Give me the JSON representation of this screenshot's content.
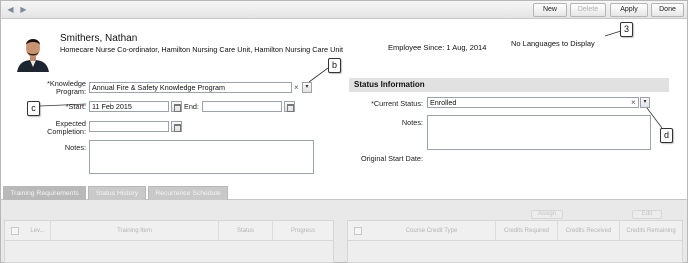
{
  "toolbar": {
    "nav_prev": "◀",
    "nav_next": "▶",
    "buttons": {
      "new": "New",
      "delete": "Delete",
      "apply": "Apply",
      "done": "Done"
    }
  },
  "employee": {
    "name": "Smithers, Nathan",
    "title": "Homecare Nurse Co-ordinator, Hamilton Nursing Care Unit, Hamilton Nursing Care Unit",
    "since": "Employee Since: 1 Aug, 2014",
    "languages": "No Languages to Display"
  },
  "form": {
    "knowledge_program_label": "*Knowledge Program:",
    "knowledge_program_value": "Annual Fire & Safety Knowledge Program",
    "start_label": "*Start:",
    "start_value": "11 Feb 2015",
    "end_label": "End:",
    "end_value": "",
    "expected_completion_label": "Expected Completion:",
    "expected_completion_value": "",
    "notes_label": "Notes:"
  },
  "status": {
    "header": "Status Information",
    "current_status_label": "*Current Status:",
    "current_status_value": "Enrolled",
    "notes_label": "Notes:",
    "original_start_label": "Original Start Date:"
  },
  "tabs": [
    "Training Requirements",
    "Status History",
    "Recurrence Schedule"
  ],
  "training_grid": {
    "columns": [
      "Lev...",
      "Training Item",
      "Status",
      "Progress"
    ]
  },
  "credit_grid": {
    "buttons": [
      "Assign",
      "Edit"
    ],
    "columns": [
      "Course Credit Type",
      "Credits Required",
      "Credits Received",
      "Credits Remaining"
    ]
  },
  "callouts": {
    "c3": "3",
    "cb": "b",
    "cc": "c",
    "cd": "d"
  },
  "icons": {
    "clear": "×",
    "dropdown": "▾"
  }
}
